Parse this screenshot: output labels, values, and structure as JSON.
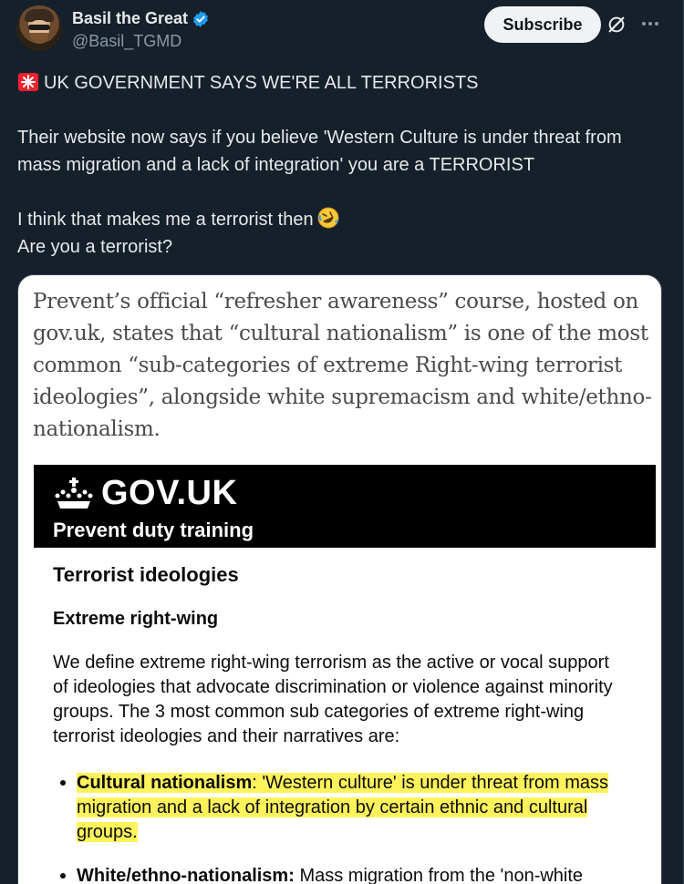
{
  "author": {
    "display_name": "Basil the Great",
    "handle": "@Basil_TGMD",
    "verified": true
  },
  "actions": {
    "subscribe_label": "Subscribe",
    "grok_icon": "grok-icon",
    "more_icon": "more-icon"
  },
  "tweet": {
    "line1": "UK GOVERNMENT SAYS WE'RE ALL TERRORISTS",
    "line2": "Their website now says if you believe 'Western Culture is under threat from mass migration and a lack of integration' you are a TERRORIST",
    "line3": "I think that makes me a terrorist then",
    "line4": "Are you a terrorist?"
  },
  "media": {
    "article_text": "Prevent’s official “refresher awareness” course, hosted on gov.uk, states that “cultural nationalism” is one of the most common “sub-categories of extreme Right-wing terrorist ideologies”, alongside white supremacism and white/ethno-nationalism.",
    "gov_title": "GOV.UK",
    "gov_subtitle": "Prevent duty training",
    "heading": "Terrorist ideologies",
    "subheading": "Extreme right-wing",
    "paragraph": "We define extreme right-wing terrorism as the active or vocal support of ideologies that advocate discrimination or violence against minority groups. The 3 most common sub categories of extreme right-wing terrorist ideologies and their narratives are:",
    "bullet1_term": "Cultural nationalism",
    "bullet1_text": ": 'Western culture' is under threat from mass migration and a lack of integration by certain ethnic and cultural groups.",
    "bullet2_term": "White/ethno-nationalism:",
    "bullet2_text": " Mass migration from the 'non-white"
  },
  "colors": {
    "background": "#15202b",
    "text": "#e7e9ea",
    "muted": "#8b98a5",
    "verified": "#1d9bf0",
    "highlight": "#fff35c"
  }
}
